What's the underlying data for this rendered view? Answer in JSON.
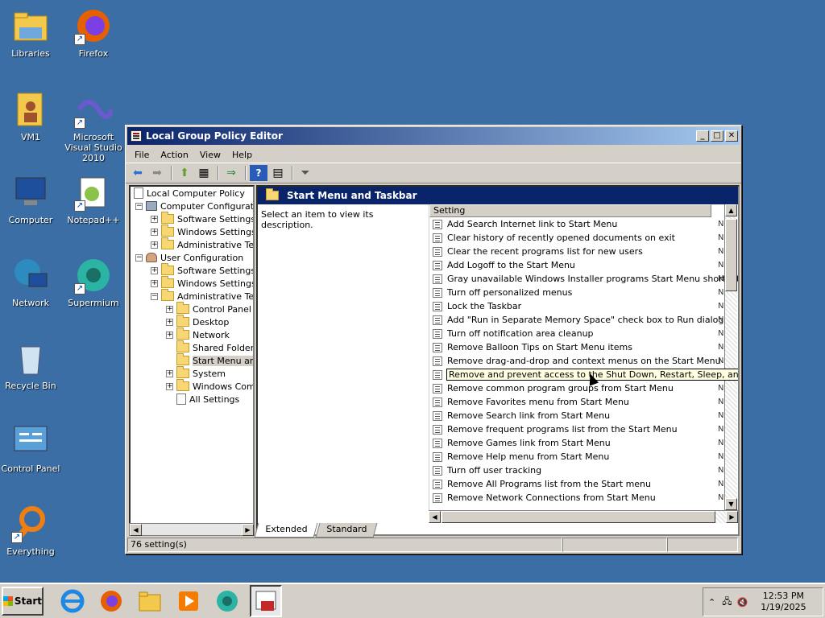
{
  "desktop": {
    "icons": [
      {
        "label": "Libraries"
      },
      {
        "label": "Firefox"
      },
      {
        "label": "VM1"
      },
      {
        "label": "Microsoft Visual Studio 2010"
      },
      {
        "label": "Computer"
      },
      {
        "label": "Notepad++"
      },
      {
        "label": "Network"
      },
      {
        "label": "Supermium"
      },
      {
        "label": "Recycle Bin"
      },
      {
        "label": "Control Panel"
      },
      {
        "label": "Everything"
      }
    ]
  },
  "window": {
    "title": "Local Group Policy Editor",
    "controls": {
      "min": "_",
      "max": "□",
      "close": "✕"
    },
    "menu": [
      "File",
      "Action",
      "View",
      "Help"
    ],
    "tree": [
      {
        "label": "Local Computer Policy"
      },
      {
        "label": "Computer Configuration"
      },
      {
        "label": "Software Settings"
      },
      {
        "label": "Windows Settings"
      },
      {
        "label": "Administrative Templates"
      },
      {
        "label": "User Configuration"
      },
      {
        "label": "Software Settings"
      },
      {
        "label": "Windows Settings"
      },
      {
        "label": "Administrative Templates"
      },
      {
        "label": "Control Panel"
      },
      {
        "label": "Desktop"
      },
      {
        "label": "Network"
      },
      {
        "label": "Shared Folders"
      },
      {
        "label": "Start Menu and Taskbar"
      },
      {
        "label": "System"
      },
      {
        "label": "Windows Components"
      },
      {
        "label": "All Settings"
      }
    ],
    "right_header": "Start Menu and Taskbar",
    "description": "Select an item to view its description.",
    "column_header": "Setting",
    "settings": [
      "Add Search Internet link to Start Menu",
      "Clear history of recently opened documents on exit",
      "Clear the recent programs list for new users",
      "Add Logoff to the Start Menu",
      "Gray unavailable Windows Installer programs Start Menu shortcuts",
      "Turn off personalized menus",
      "Lock the Taskbar",
      "Add \"Run in Separate Memory Space\" check box to Run dialog box",
      "Turn off notification area cleanup",
      "Remove Balloon Tips on Start Menu items",
      "Remove drag-and-drop and context menus on the Start Menu",
      "Remove and prevent access to the Shut Down, Restart, Sleep, and Hibernate commands",
      "Remove common program groups from Start Menu",
      "Remove Favorites menu from Start Menu",
      "Remove Search link from Start Menu",
      "Remove frequent programs list from the Start Menu",
      "Remove Games link from Start Menu",
      "Remove Help menu from Start Menu",
      "Turn off user tracking",
      "Remove All Programs list from the Start menu",
      "Remove Network Connections from Start Menu"
    ],
    "state_letter": "N",
    "tabs": [
      "Extended",
      "Standard"
    ],
    "status": "76 setting(s)"
  },
  "taskbar": {
    "start_label": "Start",
    "clock_time": "12:53 PM",
    "clock_date": "1/19/2025"
  }
}
